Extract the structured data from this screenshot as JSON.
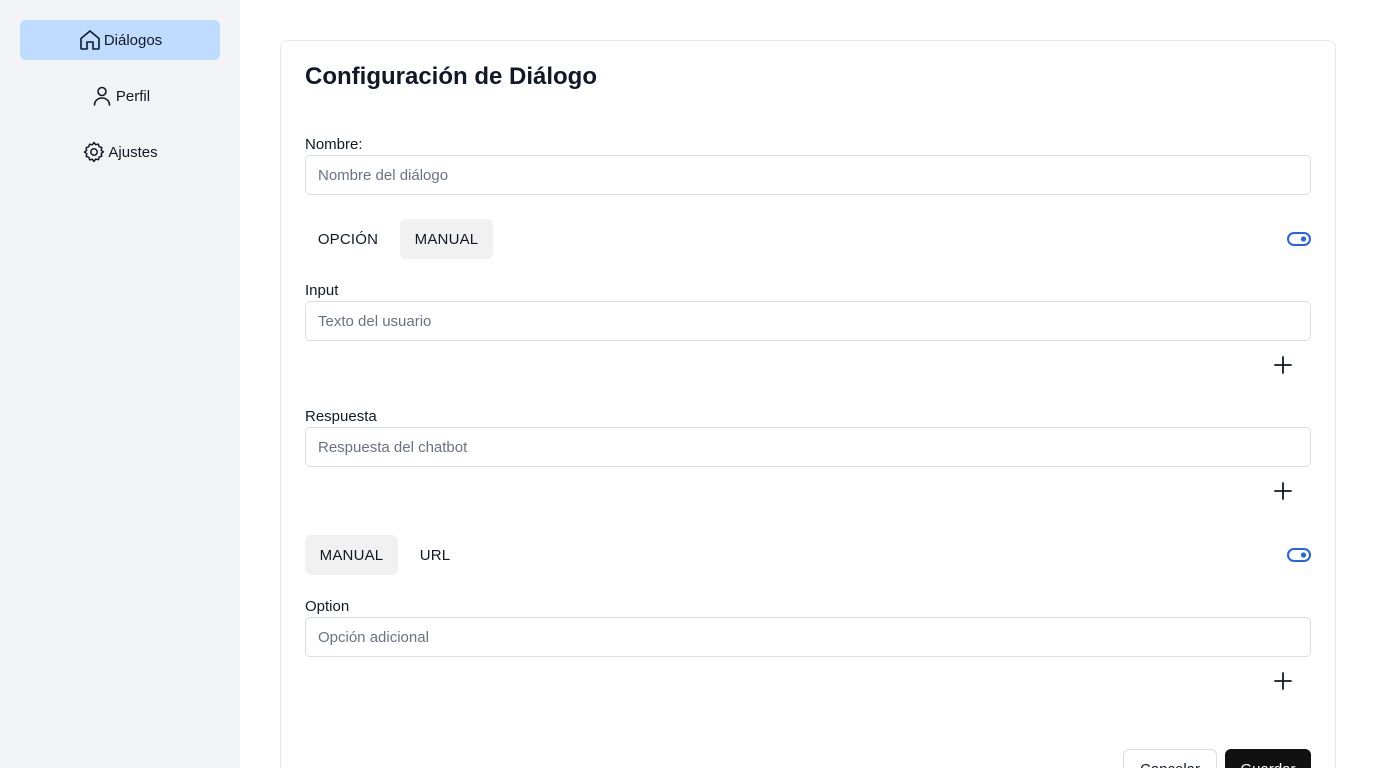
{
  "sidebar": {
    "items": [
      {
        "label": "Diálogos",
        "icon": "home-icon",
        "active": true
      },
      {
        "label": "Perfil",
        "icon": "user-icon",
        "active": false
      },
      {
        "label": "Ajustes",
        "icon": "gear-icon",
        "active": false
      }
    ]
  },
  "form": {
    "title": "Configuración de Diálogo",
    "name_label": "Nombre:",
    "name_placeholder": "Nombre del diálogo",
    "tabs1": [
      {
        "label": "OPCIÓN",
        "selected": false
      },
      {
        "label": "MANUAL",
        "selected": true
      }
    ],
    "input_label": "Input",
    "input_placeholder": "Texto del usuario",
    "response_label": "Respuesta",
    "response_placeholder": "Respuesta del chatbot",
    "tabs2": [
      {
        "label": "MANUAL",
        "selected": true
      },
      {
        "label": "URL",
        "selected": false
      }
    ],
    "option_label": "Option",
    "option_placeholder": "Opción adicional",
    "cancel_label": "Cancelar",
    "save_label": "Guardar"
  },
  "colors": {
    "accent": "#2563eb",
    "active_nav": "#bfdbfe",
    "sidebar_bg": "#f1f3f5",
    "save_button": "#111111"
  }
}
